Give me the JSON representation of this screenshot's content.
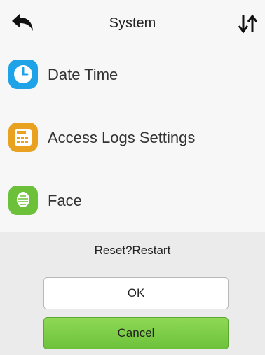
{
  "header": {
    "title": "System",
    "back_icon": "back-arrow-icon",
    "sort_icon": "sort-arrows-icon"
  },
  "menu": {
    "items": [
      {
        "label": "Date Time",
        "icon": "clock-icon",
        "color": "#1fa3e8"
      },
      {
        "label": "Access Logs Settings",
        "icon": "logs-icon",
        "color": "#e8a21f"
      },
      {
        "label": "Face",
        "icon": "face-icon",
        "color": "#6cc03a"
      }
    ]
  },
  "dialog": {
    "title": "Reset?Restart",
    "ok_label": "OK",
    "cancel_label": "Cancel"
  }
}
